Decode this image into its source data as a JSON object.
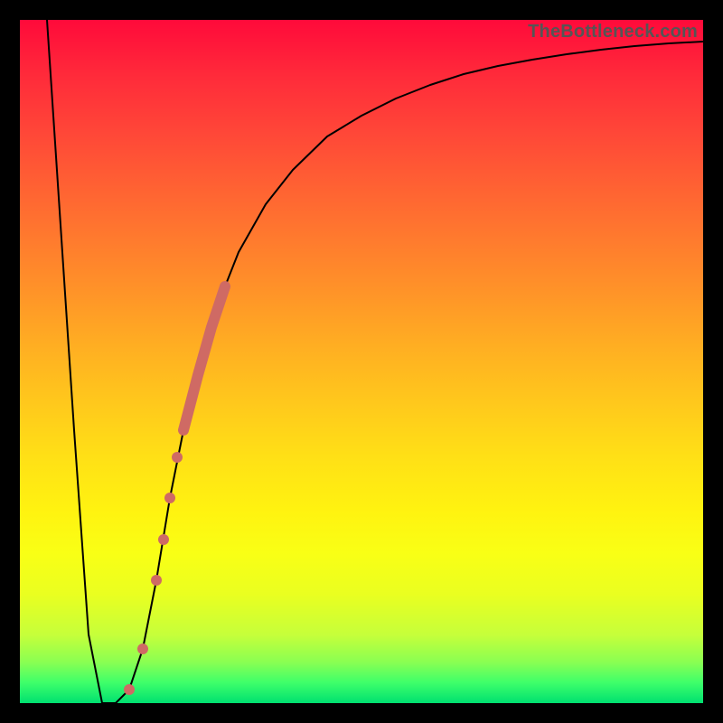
{
  "watermark": "TheBottleneck.com",
  "colors": {
    "frame": "#000000",
    "curve": "#000000",
    "marker": "#cf6a64",
    "gradient_top": "#ff0a3a",
    "gradient_bottom": "#00e070"
  },
  "chart_data": {
    "type": "line",
    "title": "",
    "xlabel": "",
    "ylabel": "",
    "xlim": [
      0,
      100
    ],
    "ylim": [
      0,
      100
    ],
    "grid": false,
    "legend": false,
    "series": [
      {
        "name": "bottleneck-curve",
        "x": [
          4,
          6,
          8,
          10,
          12,
          14,
          16,
          18,
          20,
          22,
          24,
          26,
          28,
          30,
          32,
          36,
          40,
          45,
          50,
          55,
          60,
          65,
          70,
          75,
          80,
          85,
          90,
          95,
          100
        ],
        "y": [
          100,
          70,
          40,
          10,
          0,
          0,
          2,
          8,
          18,
          30,
          40,
          48,
          55,
          61,
          66,
          73,
          78,
          83,
          86,
          88.5,
          90.5,
          92,
          93.2,
          94.2,
          95,
          95.6,
          96.1,
          96.5,
          96.8
        ]
      }
    ],
    "markers": {
      "name": "highlighted-range",
      "thick_segment": {
        "x_start": 24,
        "x_end": 30,
        "note": "dense marker cluster along curve"
      },
      "dots": [
        {
          "x": 16,
          "y": 2
        },
        {
          "x": 18,
          "y": 8
        },
        {
          "x": 20,
          "y": 18
        },
        {
          "x": 21,
          "y": 24
        },
        {
          "x": 22,
          "y": 30
        },
        {
          "x": 23,
          "y": 36
        }
      ]
    }
  }
}
